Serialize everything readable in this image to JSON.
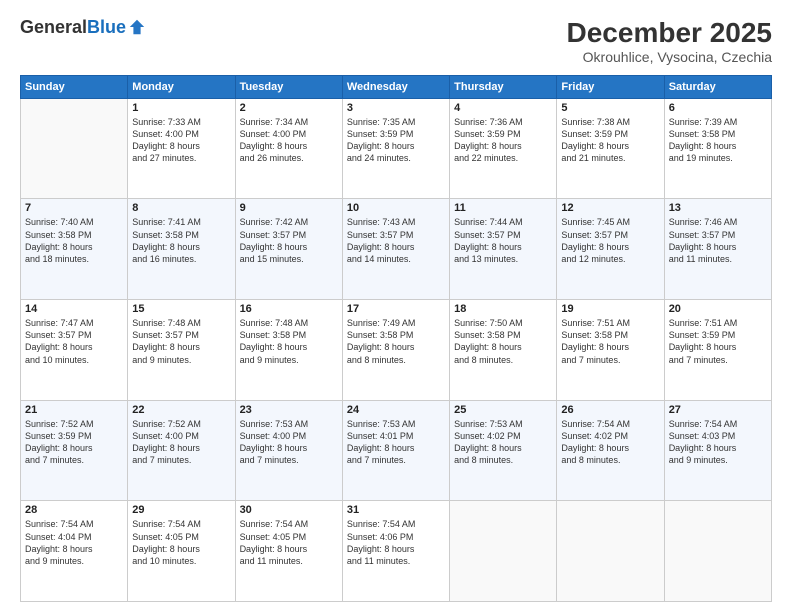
{
  "logo": {
    "general": "General",
    "blue": "Blue"
  },
  "title": "December 2025",
  "subtitle": "Okrouhlice, Vysocina, Czechia",
  "days_of_week": [
    "Sunday",
    "Monday",
    "Tuesday",
    "Wednesday",
    "Thursday",
    "Friday",
    "Saturday"
  ],
  "weeks": [
    [
      {
        "day": "",
        "sunrise": "",
        "sunset": "",
        "daylight": ""
      },
      {
        "day": "1",
        "sunrise": "Sunrise: 7:33 AM",
        "sunset": "Sunset: 4:00 PM",
        "daylight": "Daylight: 8 hours and 27 minutes."
      },
      {
        "day": "2",
        "sunrise": "Sunrise: 7:34 AM",
        "sunset": "Sunset: 4:00 PM",
        "daylight": "Daylight: 8 hours and 26 minutes."
      },
      {
        "day": "3",
        "sunrise": "Sunrise: 7:35 AM",
        "sunset": "Sunset: 3:59 PM",
        "daylight": "Daylight: 8 hours and 24 minutes."
      },
      {
        "day": "4",
        "sunrise": "Sunrise: 7:36 AM",
        "sunset": "Sunset: 3:59 PM",
        "daylight": "Daylight: 8 hours and 22 minutes."
      },
      {
        "day": "5",
        "sunrise": "Sunrise: 7:38 AM",
        "sunset": "Sunset: 3:59 PM",
        "daylight": "Daylight: 8 hours and 21 minutes."
      },
      {
        "day": "6",
        "sunrise": "Sunrise: 7:39 AM",
        "sunset": "Sunset: 3:58 PM",
        "daylight": "Daylight: 8 hours and 19 minutes."
      }
    ],
    [
      {
        "day": "7",
        "sunrise": "Sunrise: 7:40 AM",
        "sunset": "Sunset: 3:58 PM",
        "daylight": "Daylight: 8 hours and 18 minutes."
      },
      {
        "day": "8",
        "sunrise": "Sunrise: 7:41 AM",
        "sunset": "Sunset: 3:58 PM",
        "daylight": "Daylight: 8 hours and 16 minutes."
      },
      {
        "day": "9",
        "sunrise": "Sunrise: 7:42 AM",
        "sunset": "Sunset: 3:57 PM",
        "daylight": "Daylight: 8 hours and 15 minutes."
      },
      {
        "day": "10",
        "sunrise": "Sunrise: 7:43 AM",
        "sunset": "Sunset: 3:57 PM",
        "daylight": "Daylight: 8 hours and 14 minutes."
      },
      {
        "day": "11",
        "sunrise": "Sunrise: 7:44 AM",
        "sunset": "Sunset: 3:57 PM",
        "daylight": "Daylight: 8 hours and 13 minutes."
      },
      {
        "day": "12",
        "sunrise": "Sunrise: 7:45 AM",
        "sunset": "Sunset: 3:57 PM",
        "daylight": "Daylight: 8 hours and 12 minutes."
      },
      {
        "day": "13",
        "sunrise": "Sunrise: 7:46 AM",
        "sunset": "Sunset: 3:57 PM",
        "daylight": "Daylight: 8 hours and 11 minutes."
      }
    ],
    [
      {
        "day": "14",
        "sunrise": "Sunrise: 7:47 AM",
        "sunset": "Sunset: 3:57 PM",
        "daylight": "Daylight: 8 hours and 10 minutes."
      },
      {
        "day": "15",
        "sunrise": "Sunrise: 7:48 AM",
        "sunset": "Sunset: 3:57 PM",
        "daylight": "Daylight: 8 hours and 9 minutes."
      },
      {
        "day": "16",
        "sunrise": "Sunrise: 7:48 AM",
        "sunset": "Sunset: 3:58 PM",
        "daylight": "Daylight: 8 hours and 9 minutes."
      },
      {
        "day": "17",
        "sunrise": "Sunrise: 7:49 AM",
        "sunset": "Sunset: 3:58 PM",
        "daylight": "Daylight: 8 hours and 8 minutes."
      },
      {
        "day": "18",
        "sunrise": "Sunrise: 7:50 AM",
        "sunset": "Sunset: 3:58 PM",
        "daylight": "Daylight: 8 hours and 8 minutes."
      },
      {
        "day": "19",
        "sunrise": "Sunrise: 7:51 AM",
        "sunset": "Sunset: 3:58 PM",
        "daylight": "Daylight: 8 hours and 7 minutes."
      },
      {
        "day": "20",
        "sunrise": "Sunrise: 7:51 AM",
        "sunset": "Sunset: 3:59 PM",
        "daylight": "Daylight: 8 hours and 7 minutes."
      }
    ],
    [
      {
        "day": "21",
        "sunrise": "Sunrise: 7:52 AM",
        "sunset": "Sunset: 3:59 PM",
        "daylight": "Daylight: 8 hours and 7 minutes."
      },
      {
        "day": "22",
        "sunrise": "Sunrise: 7:52 AM",
        "sunset": "Sunset: 4:00 PM",
        "daylight": "Daylight: 8 hours and 7 minutes."
      },
      {
        "day": "23",
        "sunrise": "Sunrise: 7:53 AM",
        "sunset": "Sunset: 4:00 PM",
        "daylight": "Daylight: 8 hours and 7 minutes."
      },
      {
        "day": "24",
        "sunrise": "Sunrise: 7:53 AM",
        "sunset": "Sunset: 4:01 PM",
        "daylight": "Daylight: 8 hours and 7 minutes."
      },
      {
        "day": "25",
        "sunrise": "Sunrise: 7:53 AM",
        "sunset": "Sunset: 4:02 PM",
        "daylight": "Daylight: 8 hours and 8 minutes."
      },
      {
        "day": "26",
        "sunrise": "Sunrise: 7:54 AM",
        "sunset": "Sunset: 4:02 PM",
        "daylight": "Daylight: 8 hours and 8 minutes."
      },
      {
        "day": "27",
        "sunrise": "Sunrise: 7:54 AM",
        "sunset": "Sunset: 4:03 PM",
        "daylight": "Daylight: 8 hours and 9 minutes."
      }
    ],
    [
      {
        "day": "28",
        "sunrise": "Sunrise: 7:54 AM",
        "sunset": "Sunset: 4:04 PM",
        "daylight": "Daylight: 8 hours and 9 minutes."
      },
      {
        "day": "29",
        "sunrise": "Sunrise: 7:54 AM",
        "sunset": "Sunset: 4:05 PM",
        "daylight": "Daylight: 8 hours and 10 minutes."
      },
      {
        "day": "30",
        "sunrise": "Sunrise: 7:54 AM",
        "sunset": "Sunset: 4:05 PM",
        "daylight": "Daylight: 8 hours and 11 minutes."
      },
      {
        "day": "31",
        "sunrise": "Sunrise: 7:54 AM",
        "sunset": "Sunset: 4:06 PM",
        "daylight": "Daylight: 8 hours and 11 minutes."
      },
      {
        "day": "",
        "sunrise": "",
        "sunset": "",
        "daylight": ""
      },
      {
        "day": "",
        "sunrise": "",
        "sunset": "",
        "daylight": ""
      },
      {
        "day": "",
        "sunrise": "",
        "sunset": "",
        "daylight": ""
      }
    ]
  ]
}
